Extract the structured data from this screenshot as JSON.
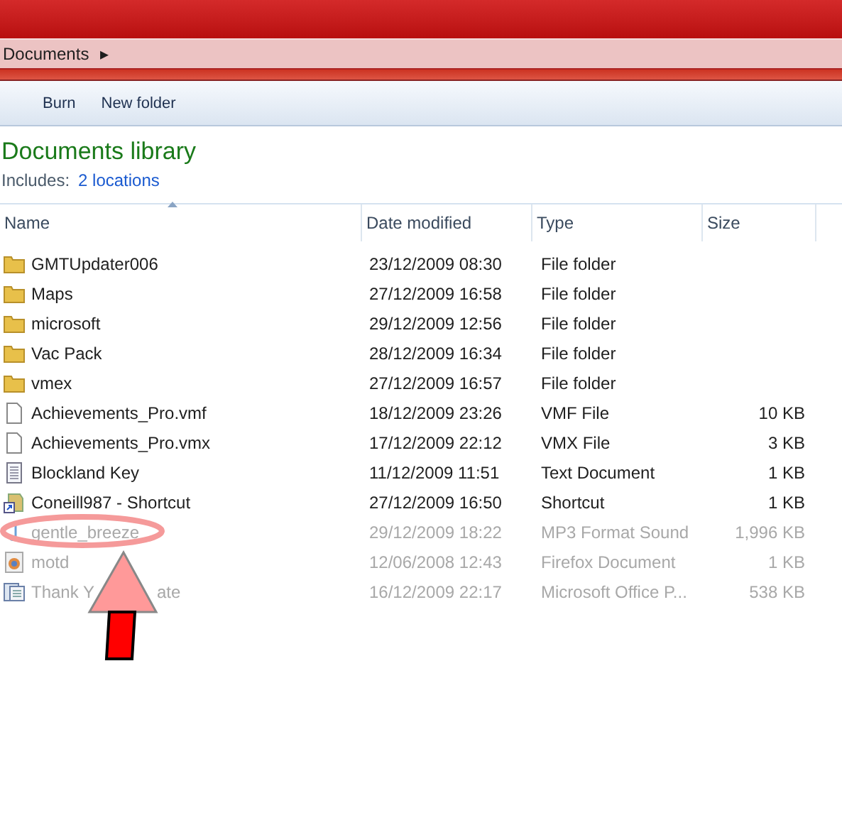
{
  "address_bar": {
    "crumb": "Documents",
    "arrow": "▸"
  },
  "toolbar": [
    "Burn",
    "New folder"
  ],
  "library": {
    "title": "Documents library",
    "includes_label": "Includes:",
    "locations_link": "2 locations"
  },
  "table": {
    "columns": [
      {
        "label": "Name",
        "sorted": true
      },
      {
        "label": "Date modified",
        "sorted": false
      },
      {
        "label": "Type",
        "sorted": false
      },
      {
        "label": "Size",
        "sorted": false
      }
    ],
    "rows": [
      {
        "kind": "folder",
        "name": [
          "GMTUpdater006"
        ],
        "date": "23/12/2009 08:30",
        "type": "File folder",
        "dimmed": false
      },
      {
        "kind": "folder",
        "name": [
          "Maps"
        ],
        "date": "27/12/2009 16:58",
        "type": "File folder",
        "dimmed": false
      },
      {
        "kind": "folder",
        "name": [
          "microsoft"
        ],
        "date": "29/12/2009 12:56",
        "type": "File folder",
        "dimmed": false
      },
      {
        "kind": "folder",
        "name": [
          "Vac Pack"
        ],
        "date": "28/12/2009 16:34",
        "type": "File folder",
        "dimmed": false
      },
      {
        "kind": "folder",
        "name": [
          "vmex"
        ],
        "date": "27/12/2009 16:57",
        "type": "File folder",
        "dimmed": false
      },
      {
        "kind": "file",
        "name": [
          "Achievements_Pro.vmf"
        ],
        "date": "18/12/2009 23:26",
        "type": "VMF File",
        "size": "10 KB",
        "dimmed": false
      },
      {
        "kind": "file",
        "name": [
          "Achievements_Pro.vmx"
        ],
        "date": "17/12/2009 22:12",
        "type": "VMX File",
        "size": "3 KB",
        "dimmed": false
      },
      {
        "kind": "text",
        "name": [
          "Blockland Key"
        ],
        "date": "11/12/2009 11:51",
        "type": "Text Document",
        "size": "1 KB",
        "dimmed": false
      },
      {
        "kind": "shortcut",
        "name": [
          "Coneill987 - Shortcut"
        ],
        "date": "27/12/2009 16:50",
        "type": "Shortcut",
        "size": "1 KB",
        "dimmed": false
      },
      {
        "kind": "music",
        "name": [
          "gentle_breeze"
        ],
        "date": "29/12/2009 18:22",
        "type": "MP3 Format Sound",
        "size": "1,996 KB",
        "dimmed": true
      },
      {
        "kind": "firefox",
        "name": [
          "motd"
        ],
        "date": "12/06/2008 12:43",
        "type": "Firefox Document",
        "size": "1 KB",
        "dimmed": true
      },
      {
        "kind": "office",
        "name": [
          "Thank Y",
          "ate"
        ],
        "date": "16/12/2009 22:17",
        "type": "Microsoft Office P...",
        "size": "538 KB",
        "dimmed": true
      }
    ]
  }
}
